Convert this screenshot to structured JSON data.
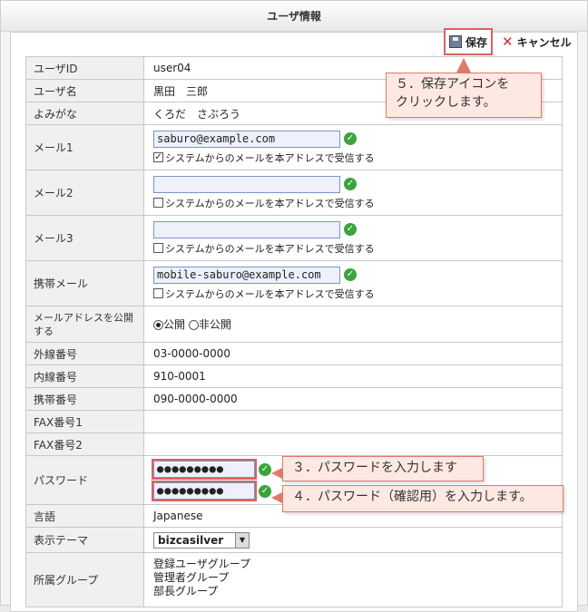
{
  "panel": {
    "title": "ユーザ情報"
  },
  "toolbar": {
    "save_label": "保存",
    "cancel_label": "キャンセル"
  },
  "rows": [
    {
      "label": "ユーザID",
      "value": "user04"
    },
    {
      "label": "ユーザ名",
      "value": "黒田　三郎"
    },
    {
      "label": "よみがな",
      "value": "くろだ　さぶろう"
    }
  ],
  "mail": [
    {
      "label": "メール1",
      "value": "saburo@example.com",
      "receive_label": "システムからのメールを本アドレスで受信する",
      "checked": true
    },
    {
      "label": "メール2",
      "value": "",
      "receive_label": "システムからのメールを本アドレスで受信する",
      "checked": false
    },
    {
      "label": "メール3",
      "value": "",
      "receive_label": "システムからのメールを本アドレスで受信する",
      "checked": false
    },
    {
      "label": "携帯メール",
      "value": "mobile-saburo@example.com",
      "receive_label": "システムからのメールを本アドレスで受信する",
      "checked": false
    }
  ],
  "publish": {
    "label": "メールアドレスを公開する",
    "public_label": "公開",
    "private_label": "非公開",
    "selected": "public"
  },
  "phones": [
    {
      "label": "外線番号",
      "value": "03-0000-0000"
    },
    {
      "label": "内線番号",
      "value": "910-0001"
    },
    {
      "label": "携帯番号",
      "value": "090-0000-0000"
    },
    {
      "label": "FAX番号1",
      "value": ""
    },
    {
      "label": "FAX番号2",
      "value": ""
    }
  ],
  "password": {
    "label": "パスワード",
    "value": "●●●●●●●●●",
    "confirm": "●●●●●●●●●"
  },
  "language": {
    "label": "言語",
    "value": "Japanese"
  },
  "theme": {
    "label": "表示テーマ",
    "value": "bizcasilver"
  },
  "groups": {
    "label": "所属グループ",
    "items": [
      "登録ユーザグループ",
      "管理者グループ",
      "部長グループ"
    ]
  },
  "callouts": {
    "save": "５．保存アイコンを\nクリックします。",
    "password": "３．パスワードを入力します",
    "confirm": "４．パスワード（確認用）を入力します。"
  },
  "colors": {
    "accent": "#e06060",
    "callout_bg": "#fde8e2",
    "check": "#3ba43b"
  }
}
